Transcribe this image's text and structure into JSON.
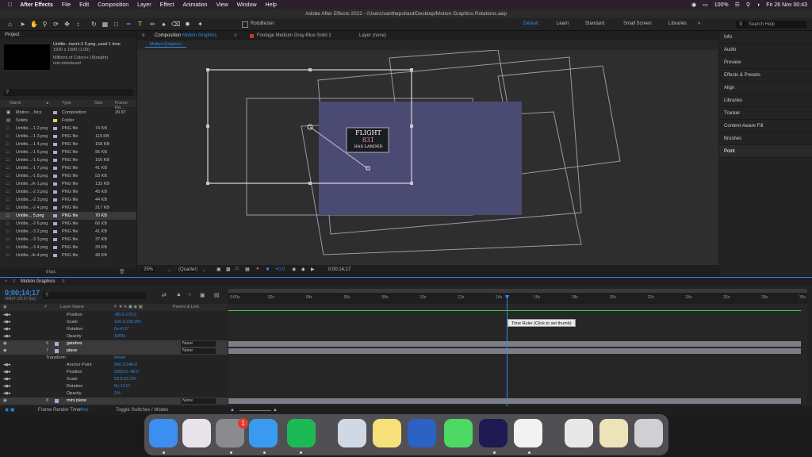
{
  "menubar": {
    "app": "After Effects",
    "items": [
      "File",
      "Edit",
      "Composition",
      "Layer",
      "Effect",
      "Animation",
      "View",
      "Window",
      "Help"
    ],
    "status": {
      "battery": "100%",
      "datetime": "Fri 26 Nov  00:43"
    }
  },
  "window": {
    "title": "Adobe After Effects 2022 - /Users/xanthepollard/Desktop/Motion Graphics Rotations.aep"
  },
  "toolbar": {
    "rotobezier": "RotoBezier",
    "workspaces": [
      "Default",
      "Learn",
      "Standard",
      "Small Screen",
      "Libraries"
    ],
    "search_placeholder": "Search Help"
  },
  "project": {
    "title": "Project",
    "selected_name": "Untitle...twork-2 5.png",
    "used": ", used 1 time",
    "dims": "1920 x 1080 (1.00)",
    "colors": "Millions of Colors+ (Straight)",
    "interlace": "non-interlaced",
    "columns": {
      "name": "Name",
      "type": "Type",
      "size": "Size",
      "fps": "Frame Ra..."
    },
    "items": [
      {
        "name": "Motion ...hics",
        "type": "Composition",
        "size": "",
        "fps": "29.97",
        "color": "#b6a5d6"
      },
      {
        "name": "Solids",
        "type": "Folder",
        "size": "",
        "fps": "",
        "color": "#e4d35a"
      },
      {
        "name": "Untitle...-1 2.png",
        "type": "PNG file",
        "size": "74 KB",
        "fps": "",
        "color": "#b6a5d6"
      },
      {
        "name": "Untitle...-1 3.png",
        "type": "PNG file",
        "size": "119 KB",
        "fps": "",
        "color": "#b6a5d6"
      },
      {
        "name": "Untitle...-1 4.png",
        "type": "PNG file",
        "size": "158 KB",
        "fps": "",
        "color": "#b6a5d6"
      },
      {
        "name": "Untitle...-1 5.png",
        "type": "PNG file",
        "size": "95 KB",
        "fps": "",
        "color": "#b6a5d6"
      },
      {
        "name": "Untitle...-1 6.png",
        "type": "PNG file",
        "size": "150 KB",
        "fps": "",
        "color": "#b6a5d6"
      },
      {
        "name": "Untitle...-1 7.png",
        "type": "PNG file",
        "size": "41 KB",
        "fps": "",
        "color": "#b6a5d6"
      },
      {
        "name": "Untitle...-1 8.png",
        "type": "PNG file",
        "size": "53 KB",
        "fps": "",
        "color": "#b6a5d6"
      },
      {
        "name": "Untitle...rk-1.png",
        "type": "PNG file",
        "size": "133 KB",
        "fps": "",
        "color": "#b6a5d6"
      },
      {
        "name": "Untitle...-2 2.png",
        "type": "PNG file",
        "size": "45 KB",
        "fps": "",
        "color": "#b6a5d6"
      },
      {
        "name": "Untitle...-2 3.png",
        "type": "PNG file",
        "size": "44 KB",
        "fps": "",
        "color": "#b6a5d6"
      },
      {
        "name": "Untitle...-2 4.png",
        "type": "PNG file",
        "size": "317 KB",
        "fps": "",
        "color": "#b6a5d6"
      },
      {
        "name": "Untitle... 5.png",
        "type": "PNG file",
        "size": "70 KB",
        "fps": "",
        "color": "#b6a5d6",
        "selected": true
      },
      {
        "name": "Untitle...-2 6.png",
        "type": "PNG file",
        "size": "66 KB",
        "fps": "",
        "color": "#b6a5d6"
      },
      {
        "name": "Untitle...-3 2.png",
        "type": "PNG file",
        "size": "41 KB",
        "fps": "",
        "color": "#b6a5d6"
      },
      {
        "name": "Untitle...-3 3.png",
        "type": "PNG file",
        "size": "37 KB",
        "fps": "",
        "color": "#b6a5d6"
      },
      {
        "name": "Untitle...-3 4.png",
        "type": "PNG file",
        "size": "39 KB",
        "fps": "",
        "color": "#b6a5d6"
      },
      {
        "name": "Untitle...rk-4.png",
        "type": "PNG file",
        "size": "48 KB",
        "fps": "",
        "color": "#b6a5d6"
      }
    ],
    "bpc": "8 bpc"
  },
  "composition": {
    "tab_prefix": "Composition",
    "tab_name": "Motion Graphics",
    "footage_tab": "Footage Medium Gray-Blue Solid 1",
    "layer_tab": "Layer (none)",
    "subtab": "Motion Graphics",
    "zoom": "25%",
    "quality": "(Quarter)",
    "exposure": "+0.0",
    "timecode": "0;00;14;17",
    "card_lines": [
      "FLIGHT",
      "831",
      "HAS LANDED"
    ],
    "bg_color": "#4b4a72"
  },
  "right_panels": [
    "Info",
    "Audio",
    "Preview",
    "Effects & Presets",
    "Align",
    "Libraries",
    "Tracker",
    "Content-Aware Fill",
    "Brushes",
    "Point"
  ],
  "timeline": {
    "tab": "Motion Graphics",
    "timecode": "0;00;14;17",
    "fps_label": "00437 (29.97 fps)",
    "columns": {
      "num": "#",
      "layer": "Layer Name",
      "parent": "Parent & Link"
    },
    "ruler": [
      "0:00s",
      "02s",
      "04s",
      "06s",
      "08s",
      "10s",
      "12s",
      "14s",
      "16s",
      "18s",
      "20s",
      "22s",
      "24s",
      "26s",
      "28s",
      "30s"
    ],
    "rows": [
      {
        "kind": "prop",
        "label": "Position",
        "value": "-80.0,279.0"
      },
      {
        "kind": "prop",
        "label": "Scale",
        "value": "100.0,100.0%"
      },
      {
        "kind": "prop",
        "label": "Rotation",
        "value": "0x+0.0°"
      },
      {
        "kind": "prop",
        "label": "Opacity",
        "value": "100%"
      },
      {
        "kind": "layer",
        "num": "6",
        "label": "gatebox",
        "parent": "None"
      },
      {
        "kind": "layer",
        "num": "7",
        "label": "plane",
        "parent": "None"
      },
      {
        "kind": "group",
        "label": "Transform",
        "value": "Reset"
      },
      {
        "kind": "prop",
        "label": "Anchor Point",
        "value": "960.0,540.0"
      },
      {
        "kind": "prop",
        "label": "Position",
        "value": "2269.0,-48.0"
      },
      {
        "kind": "prop",
        "label": "Scale",
        "value": "53.6,53.2%"
      },
      {
        "kind": "prop",
        "label": "Rotation",
        "value": "0x-13.0°"
      },
      {
        "kind": "prop",
        "label": "Opacity",
        "value": "1%"
      },
      {
        "kind": "layer",
        "num": "8",
        "label": "mini plane",
        "parent": "None"
      }
    ],
    "tooltip": "Time Ruler (Click to set thumb)",
    "footer_render": "Frame Render Time",
    "footer_ms": "4ms",
    "footer_toggle": "Toggle Switches / Modes"
  },
  "dock": {
    "badge": "1",
    "apps": [
      {
        "name": "finder",
        "color": "#3c8ff0"
      },
      {
        "name": "launchpad",
        "color": "#e9e4ec"
      },
      {
        "name": "system-preferences",
        "color": "#8a8a8f"
      },
      {
        "name": "safari",
        "color": "#3a9af0"
      },
      {
        "name": "spotify",
        "color": "#1db954"
      },
      {
        "name": "preview",
        "color": "#cfd9e6"
      },
      {
        "name": "notes",
        "color": "#f7e07a"
      },
      {
        "name": "word",
        "color": "#2b62c4"
      },
      {
        "name": "messages",
        "color": "#4cd964"
      },
      {
        "name": "after-effects",
        "color": "#1f1a54"
      },
      {
        "name": "photos",
        "color": "#f2f2f2"
      },
      {
        "name": "documents",
        "color": "#e8e8e8"
      },
      {
        "name": "notes-doc",
        "color": "#ece4b8"
      },
      {
        "name": "trash",
        "color": "#d0d0d2"
      }
    ]
  }
}
